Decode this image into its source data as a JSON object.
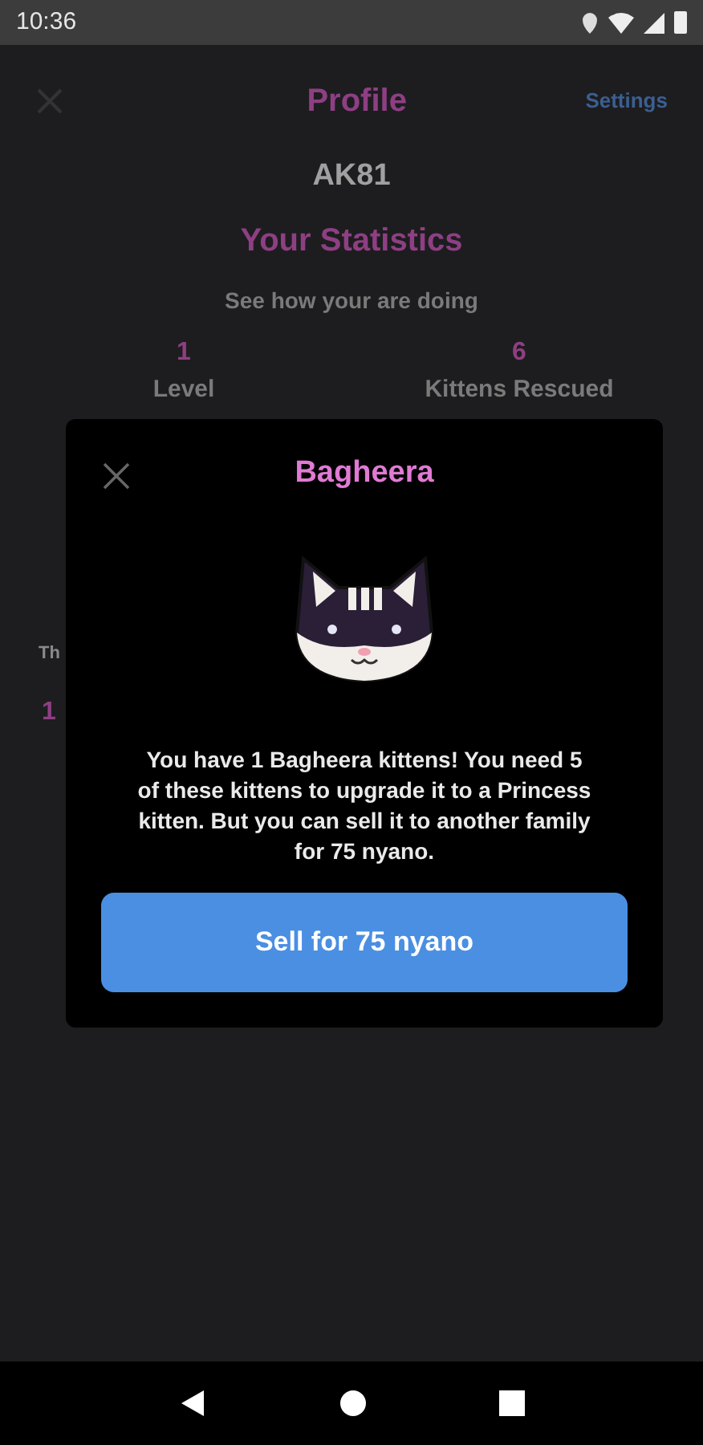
{
  "status_bar": {
    "time": "10:36"
  },
  "header": {
    "title": "Profile",
    "settings_link": "Settings"
  },
  "username": "AK81",
  "statistics": {
    "title": "Your Statistics",
    "subtitle": "See how your are doing",
    "items": [
      {
        "value": "1",
        "label": "Level"
      },
      {
        "value": "6",
        "label": "Kittens Rescued"
      }
    ]
  },
  "behind_modal": {
    "text_1": "Th",
    "text_2": "1"
  },
  "modal": {
    "title": "Bagheera",
    "message": "You have 1 Bagheera kittens! You need 5 of these kittens to upgrade it to a Princess kitten. But you can sell it to another family for 75 nyano.",
    "button": "Sell for 75 nyano"
  }
}
